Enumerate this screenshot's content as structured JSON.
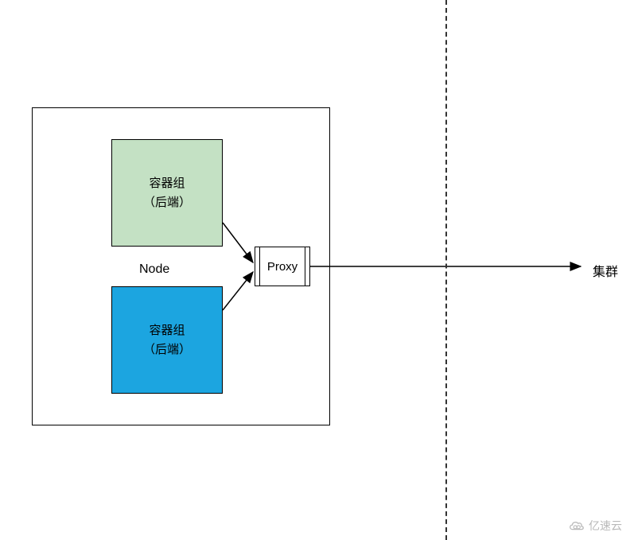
{
  "node": {
    "label": "Node",
    "pod_green": {
      "line1": "容器组",
      "line2": "（后端）"
    },
    "pod_blue": {
      "line1": "容器组",
      "line2": "（后端）"
    },
    "proxy_label": "Proxy"
  },
  "cluster_label": "集群",
  "watermark_text": "亿速云",
  "colors": {
    "pod_green_bg": "#c4e1c4",
    "pod_blue_bg": "#1ca5e0",
    "border": "#000000",
    "dashed": "#333333"
  }
}
